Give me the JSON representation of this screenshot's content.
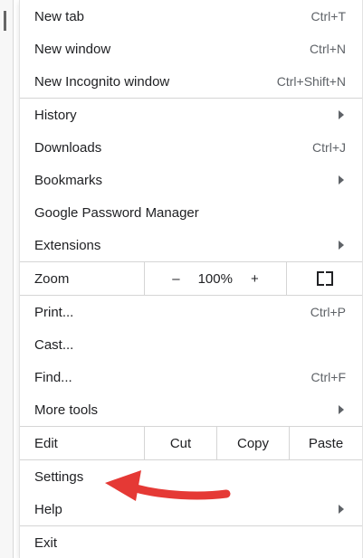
{
  "menu": {
    "group1": [
      {
        "label": "New tab",
        "shortcut": "Ctrl+T"
      },
      {
        "label": "New window",
        "shortcut": "Ctrl+N"
      },
      {
        "label": "New Incognito window",
        "shortcut": "Ctrl+Shift+N"
      }
    ],
    "group2": [
      {
        "label": "History",
        "has_submenu": true
      },
      {
        "label": "Downloads",
        "shortcut": "Ctrl+J"
      },
      {
        "label": "Bookmarks",
        "has_submenu": true
      },
      {
        "label": "Google Password Manager"
      },
      {
        "label": "Extensions",
        "has_submenu": true
      }
    ],
    "zoom": {
      "label": "Zoom",
      "minus": "–",
      "value": "100%",
      "plus": "+",
      "fullscreen_icon": "fullscreen-icon"
    },
    "group3": [
      {
        "label": "Print...",
        "shortcut": "Ctrl+P"
      },
      {
        "label": "Cast..."
      },
      {
        "label": "Find...",
        "shortcut": "Ctrl+F"
      },
      {
        "label": "More tools",
        "has_submenu": true
      }
    ],
    "edit": {
      "label": "Edit",
      "cut": "Cut",
      "copy": "Copy",
      "paste": "Paste"
    },
    "group4": [
      {
        "label": "Settings"
      },
      {
        "label": "Help",
        "has_submenu": true
      }
    ],
    "exit": {
      "label": "Exit"
    }
  },
  "colors": {
    "annotation_arrow": "#e53935",
    "separator": "#d5d5d5",
    "text": "#202124",
    "shortcut": "#5f6368"
  }
}
